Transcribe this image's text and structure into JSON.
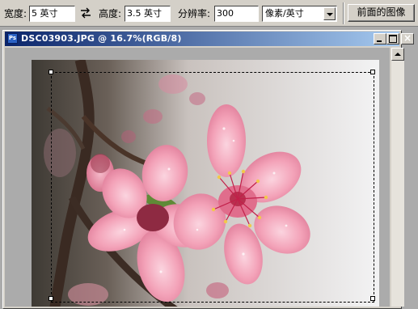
{
  "options_bar": {
    "width_label": "宽度:",
    "width_value": "5 英寸",
    "height_label": "高度:",
    "height_value": "3.5 英寸",
    "resolution_label": "分辨率:",
    "resolution_value": "300",
    "unit_selected": "像素/英寸",
    "front_image_button": "前面的图像",
    "icons": [
      "swap-icon",
      "dropdown-arrow-icon"
    ]
  },
  "document": {
    "title": "DSC03903.JPG @ 16.7%(RGB/8)",
    "icon": "photoshop-doc-icon",
    "close_glyph": "×",
    "controls": [
      "minimize-icon",
      "maximize-icon",
      "close-icon"
    ]
  },
  "colors": {
    "titlebar_start": "#0a246a",
    "titlebar_end": "#a6caf0",
    "blossom_pink": "#f4a8bd",
    "workspace_gray": "#ababab"
  }
}
